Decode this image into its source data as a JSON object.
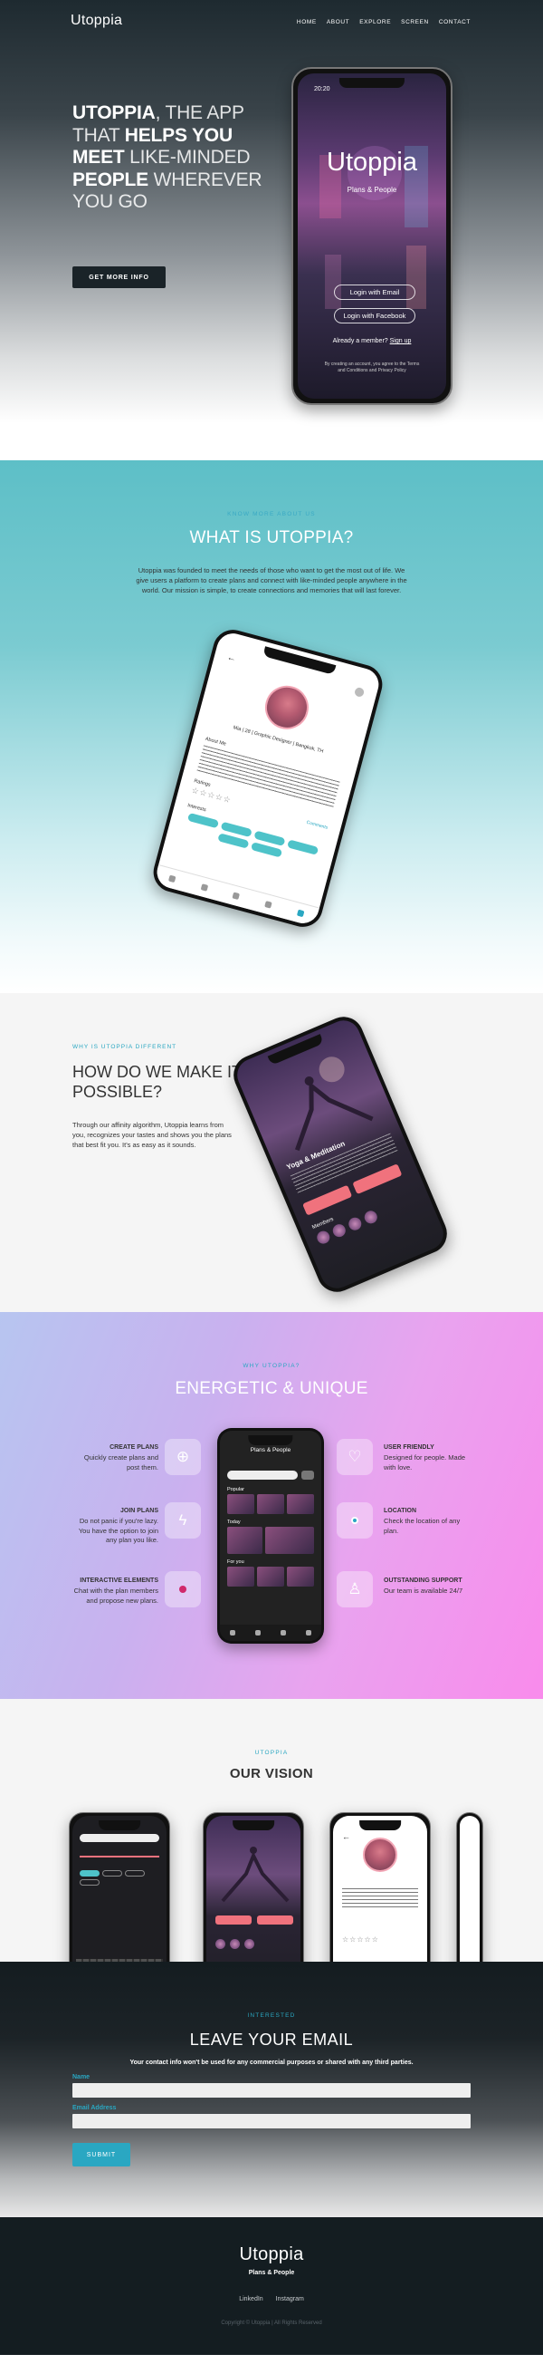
{
  "brand": "Utoppia",
  "nav": [
    "HOME",
    "ABOUT",
    "EXPLORE",
    "SCREEN",
    "CONTACT"
  ],
  "hero": {
    "heading": [
      {
        "text": "UTOPPIA",
        "style": "bold"
      },
      {
        "text": ", THE APP THAT ",
        "style": "light"
      },
      {
        "text": "HELPS YOU MEET",
        "style": "bold"
      },
      {
        "text": " LIKE-MINDED ",
        "style": "light"
      },
      {
        "text": "PEOPLE",
        "style": "bold"
      },
      {
        "text": " WHEREVER YOU GO",
        "style": "light"
      }
    ],
    "cta": "GET MORE INFO",
    "phone": {
      "time": "20:20",
      "title": "Utoppia",
      "subtitle": "Plans & People",
      "login_email": "Login with Email",
      "login_facebook": "Login with Facebook",
      "member_prefix": "Already a member?",
      "member_link": "Sign up",
      "legal": "By creating an account, you agree to the Terms and Conditions and Privacy Policy"
    }
  },
  "about": {
    "label": "KNOW MORE ABOUT US",
    "title": "WHAT IS UTOPPIA?",
    "body": "Utoppia was founded to meet the needs of those who want to get the most out of life. We give users a platform to create plans and connect with like-minded people anywhere in the world. Our mission is simple, to create connections and memories that will last forever.",
    "phone": {
      "profile_line": "Mia | 28 | Graphic Designer | Bangkok, TH",
      "about_label": "About Me",
      "ratings_label": "Ratings",
      "interests_label": "Interests",
      "comments": "Comments"
    }
  },
  "different": {
    "label": "WHY IS UTOPPIA DIFFERENT",
    "title": "HOW DO WE MAKE IT POSSIBLE?",
    "body": "Through our affinity algorithm, Utoppia learns from you, recognizes your tastes and shows you the plans that best fit you. It's as easy as it sounds.",
    "phone": {
      "plan_title": "Yoga & Meditation",
      "members_label": "Members"
    }
  },
  "energetic": {
    "label": "WHY UTOPPIA?",
    "title": "ENERGETIC & UNIQUE",
    "features": [
      {
        "title": "CREATE PLANS",
        "text": "Quickly create plans and post them.",
        "icon": "plus-circle-icon"
      },
      {
        "title": "JOIN PLANS",
        "text": "Do not panic if you're lazy. You have the option to join any plan you like.",
        "icon": "lightning-icon"
      },
      {
        "title": "INTERACTIVE ELEMENTS",
        "text": "Chat with the plan members and propose new plans.",
        "icon": "chat-dot-icon"
      },
      {
        "title": "USER FRIENDLY",
        "text": "Designed for people. Made with love.",
        "icon": "heart-icon"
      },
      {
        "title": "LOCATION",
        "text": "Check the location of any plan.",
        "icon": "location-icon"
      },
      {
        "title": "OUTSTANDING SUPPORT",
        "text": "Our team is available 24/7",
        "icon": "support-icon"
      }
    ],
    "phone": {
      "title": "Plans & People",
      "popular": "Popular",
      "today": "Today",
      "for_you": "For you"
    }
  },
  "vision": {
    "label": "UTOPPIA",
    "title": "OUR VISION"
  },
  "email": {
    "label": "INTERESTED",
    "title": "LEAVE YOUR EMAIL",
    "note": "Your contact info won't be used for any commercial purposes or shared with any third parties.",
    "name_label": "Name",
    "email_label": "Email Address",
    "submit": "SUBMIT"
  },
  "footer": {
    "brand": "Utoppia",
    "tagline": "Plans & People",
    "links": [
      "LinkedIn",
      "Instagram"
    ],
    "copyright": "Copyright © Utoppia | All Rights Reserved"
  }
}
